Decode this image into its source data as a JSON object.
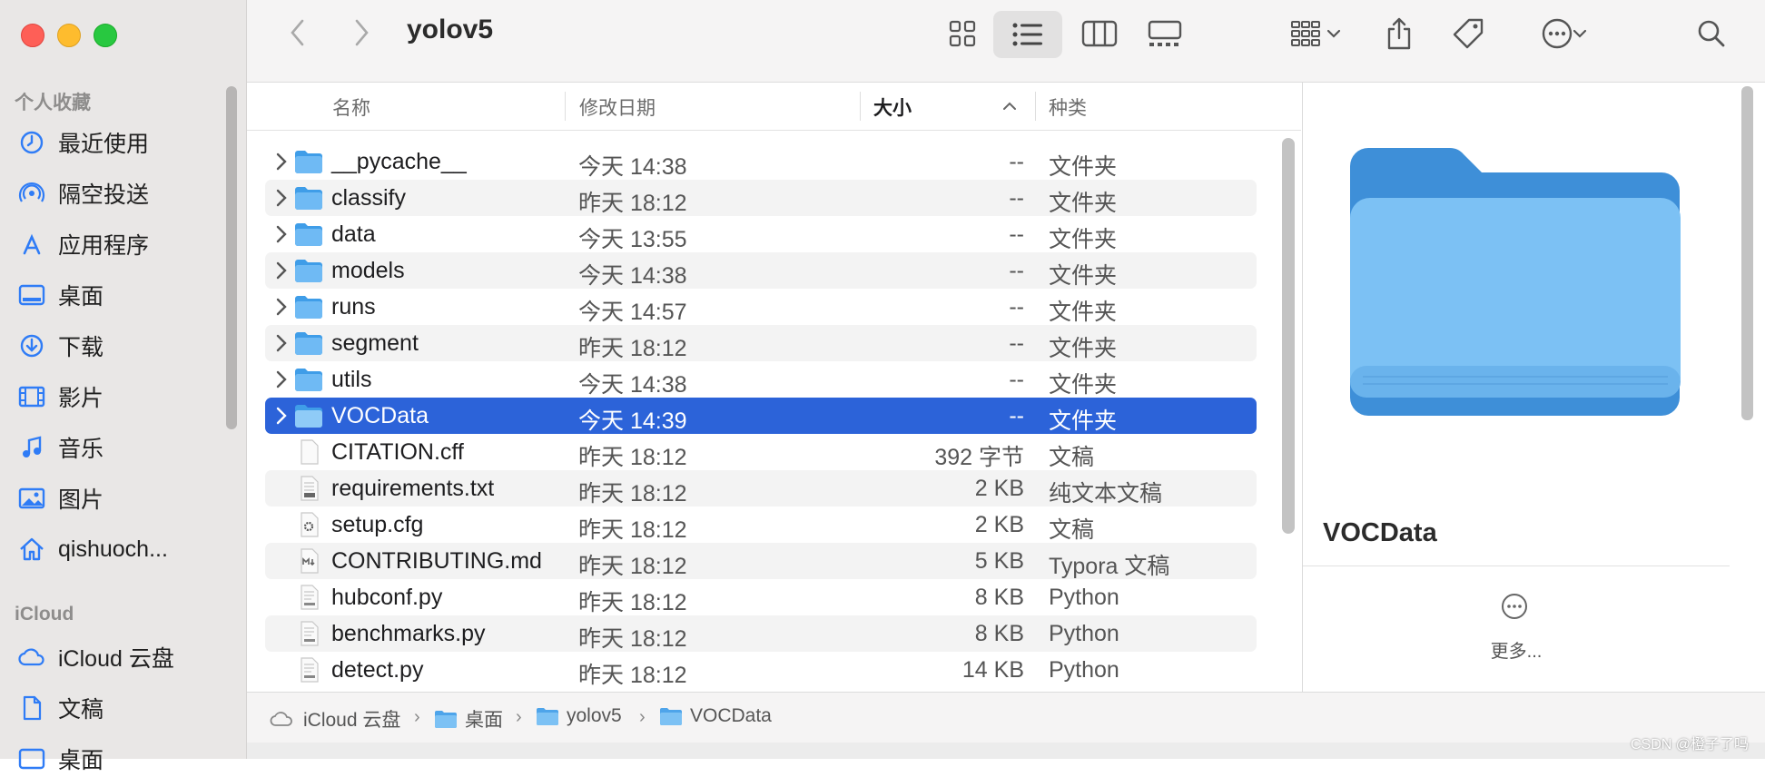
{
  "window": {
    "title": "yolov5"
  },
  "sidebar": {
    "favorites_header": "个人收藏",
    "favorites": [
      {
        "label": "最近使用",
        "icon": "clock-icon"
      },
      {
        "label": "隔空投送",
        "icon": "airdrop-icon"
      },
      {
        "label": "应用程序",
        "icon": "applications-icon"
      },
      {
        "label": "桌面",
        "icon": "desktop-icon"
      },
      {
        "label": "下载",
        "icon": "download-icon"
      },
      {
        "label": "影片",
        "icon": "film-icon"
      },
      {
        "label": "音乐",
        "icon": "music-icon"
      },
      {
        "label": "图片",
        "icon": "photo-icon"
      },
      {
        "label": "qishuoch...",
        "icon": "home-icon"
      }
    ],
    "icloud_header": "iCloud",
    "icloud": [
      {
        "label": "iCloud 云盘",
        "icon": "cloud-icon"
      },
      {
        "label": "文稿",
        "icon": "document-icon"
      },
      {
        "label": "桌面",
        "icon": "desktop-icon"
      }
    ]
  },
  "columns": {
    "name": "名称",
    "date": "修改日期",
    "size": "大小",
    "kind": "种类"
  },
  "files": [
    {
      "name": "__pycache__",
      "date": "今天 14:38",
      "size": "--",
      "kind": "文件夹",
      "type": "folder"
    },
    {
      "name": "classify",
      "date": "昨天 18:12",
      "size": "--",
      "kind": "文件夹",
      "type": "folder"
    },
    {
      "name": "data",
      "date": "今天 13:55",
      "size": "--",
      "kind": "文件夹",
      "type": "folder"
    },
    {
      "name": "models",
      "date": "今天 14:38",
      "size": "--",
      "kind": "文件夹",
      "type": "folder"
    },
    {
      "name": "runs",
      "date": "今天 14:57",
      "size": "--",
      "kind": "文件夹",
      "type": "folder"
    },
    {
      "name": "segment",
      "date": "昨天 18:12",
      "size": "--",
      "kind": "文件夹",
      "type": "folder"
    },
    {
      "name": "utils",
      "date": "今天 14:38",
      "size": "--",
      "kind": "文件夹",
      "type": "folder"
    },
    {
      "name": "VOCData",
      "date": "今天 14:39",
      "size": "--",
      "kind": "文件夹",
      "type": "folder",
      "selected": true
    },
    {
      "name": "CITATION.cff",
      "date": "昨天 18:12",
      "size": "392 字节",
      "kind": "文稿",
      "type": "blank"
    },
    {
      "name": "requirements.txt",
      "date": "昨天 18:12",
      "size": "2 KB",
      "kind": "纯文本文稿",
      "type": "txt"
    },
    {
      "name": "setup.cfg",
      "date": "昨天 18:12",
      "size": "2 KB",
      "kind": "文稿",
      "type": "cfg"
    },
    {
      "name": "CONTRIBUTING.md",
      "date": "昨天 18:12",
      "size": "5 KB",
      "kind": "Typora 文稿",
      "type": "md"
    },
    {
      "name": "hubconf.py",
      "date": "昨天 18:12",
      "size": "8 KB",
      "kind": "Python",
      "type": "py"
    },
    {
      "name": "benchmarks.py",
      "date": "昨天 18:12",
      "size": "8 KB",
      "kind": "Python",
      "type": "py"
    },
    {
      "name": "detect.py",
      "date": "昨天 18:12",
      "size": "14 KB",
      "kind": "Python",
      "type": "py"
    }
  ],
  "preview": {
    "name": "VOCData",
    "more_label": "更多..."
  },
  "pathbar": [
    {
      "label": "iCloud 云盘",
      "icon": "cloud-icon"
    },
    {
      "label": "桌面",
      "icon": "folder-icon"
    },
    {
      "label": "yolov5",
      "icon": "folder-icon"
    },
    {
      "label": "VOCData",
      "icon": "folder-icon"
    }
  ],
  "watermark": "CSDN @橙子了吗",
  "colors": {
    "selection": "#2c63d9",
    "folder": "#5aaef0",
    "sidebar_icon": "#2f7cf6"
  }
}
